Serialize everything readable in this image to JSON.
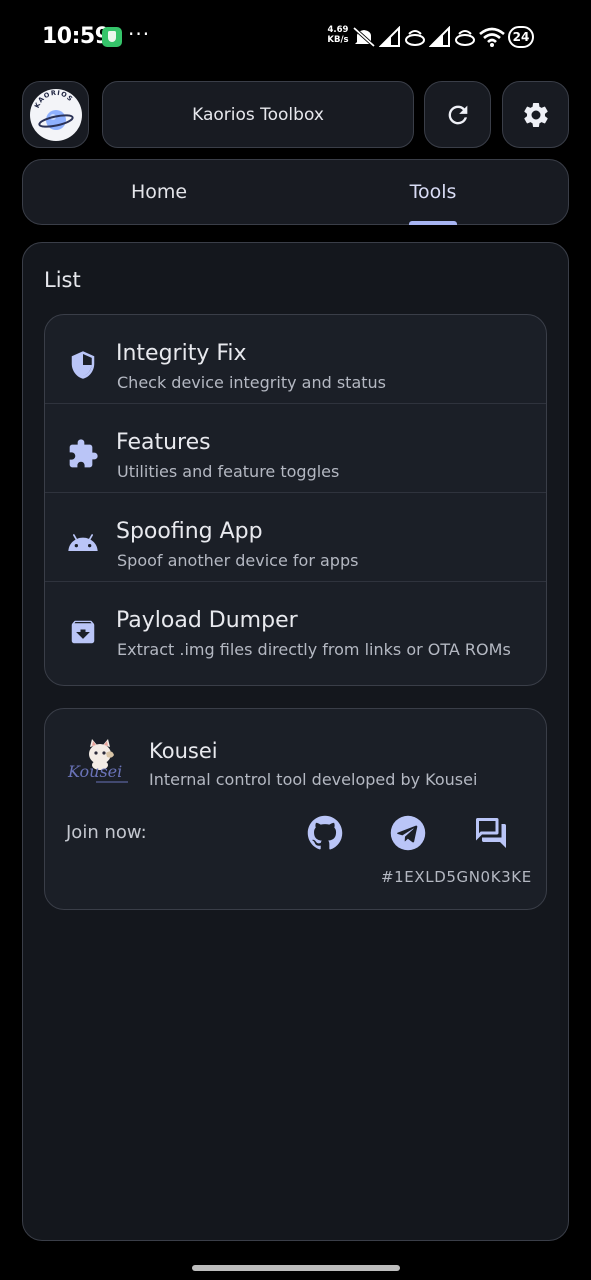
{
  "status_bar": {
    "time": "10:59",
    "more": "···",
    "net_speed_value": "4.69",
    "net_speed_unit": "KB/s",
    "battery": "24"
  },
  "app_bar": {
    "logo_text": "KAORIOS",
    "title": "Kaorios Toolbox",
    "refresh_icon": "refresh-icon",
    "settings_icon": "gear-icon"
  },
  "tabs": [
    {
      "label": "Home",
      "active": false
    },
    {
      "label": "Tools",
      "active": true
    }
  ],
  "list": {
    "title": "List",
    "items": [
      {
        "icon": "shield-icon",
        "title": "Integrity Fix",
        "subtitle": "Check device integrity and status"
      },
      {
        "icon": "puzzle-icon",
        "title": "Features",
        "subtitle": "Utilities and feature toggles"
      },
      {
        "icon": "android-icon",
        "title": "Spoofing App",
        "subtitle": "Spoof another device for apps"
      },
      {
        "icon": "archive-icon",
        "title": "Payload Dumper",
        "subtitle": "Extract .img files directly from links or OTA ROMs"
      }
    ]
  },
  "author": {
    "avatar_text": "Kousei",
    "name": "Kousei",
    "description": "Internal control tool developed by Kousei",
    "join_label": "Join now:",
    "links": [
      "github-icon",
      "telegram-icon",
      "chat-icon"
    ],
    "device_id": "#1EXLD5GN0K3KE"
  },
  "colors": {
    "background": "#000000",
    "surface": "#181b22",
    "card": "#1b1f27",
    "accent": "#a7b4f2",
    "icon": "#bac5f7"
  }
}
